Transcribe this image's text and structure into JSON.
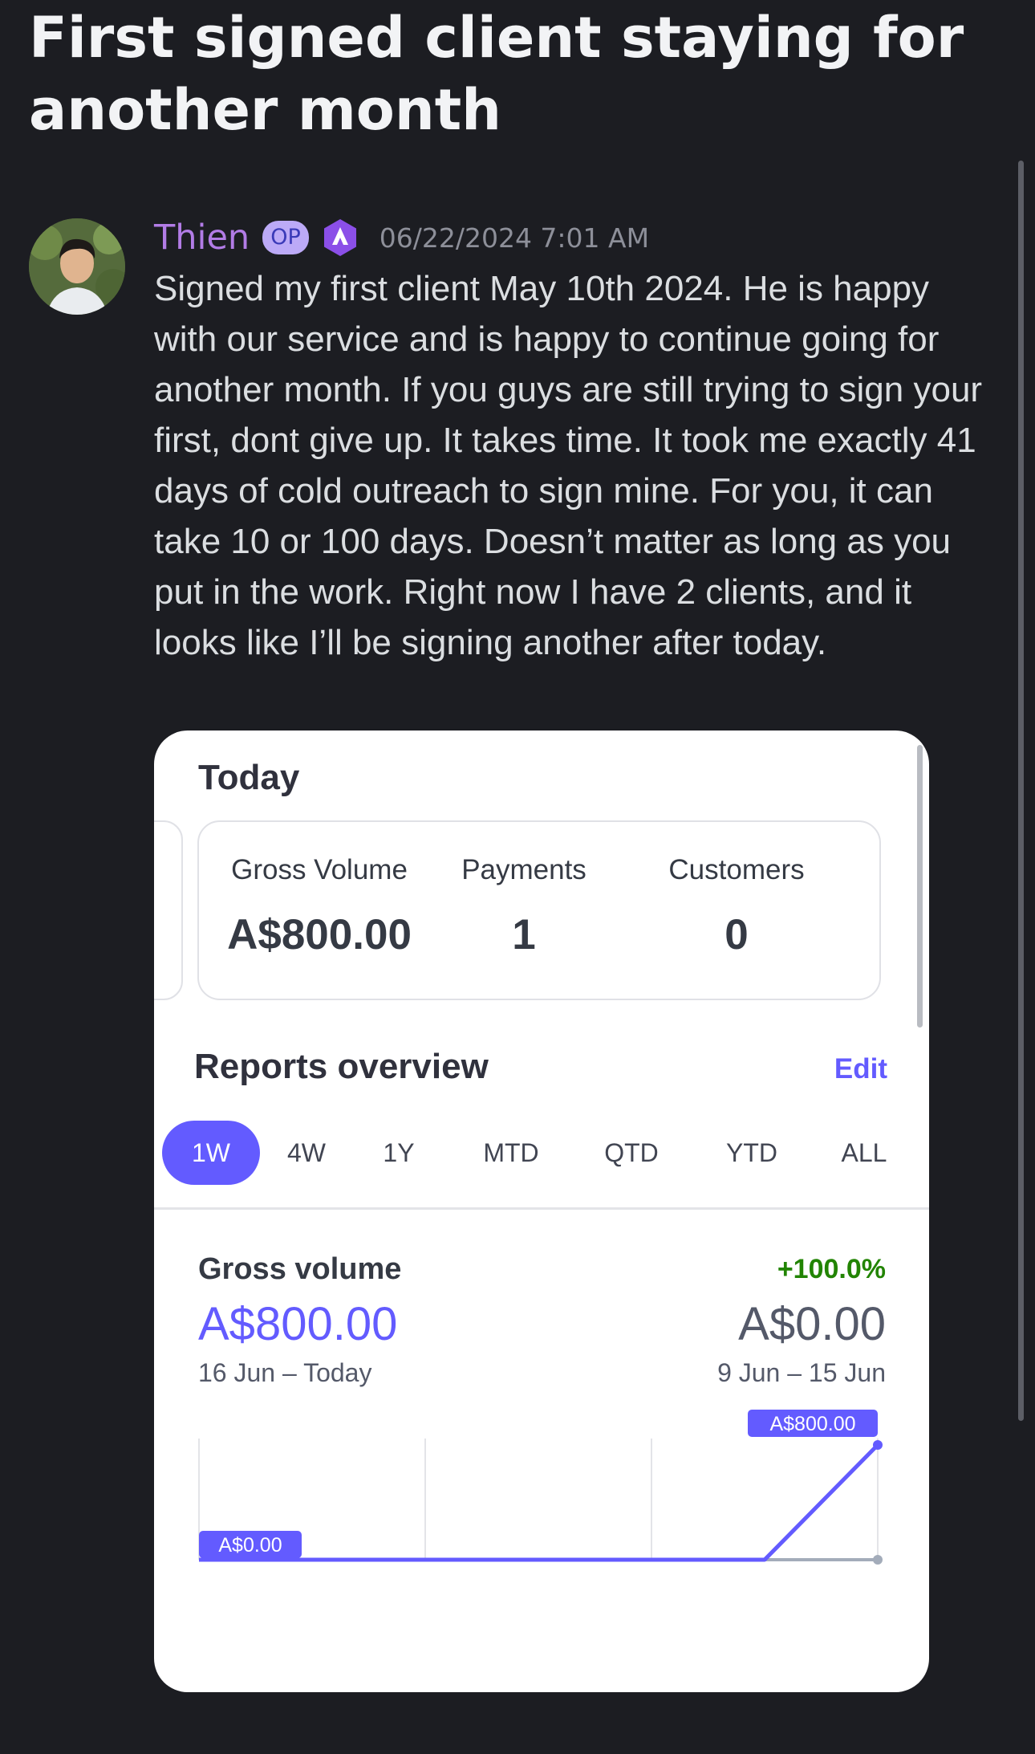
{
  "post": {
    "title": "First signed client staying for another month"
  },
  "message": {
    "author": "Thien",
    "op_badge": "OP",
    "role_icon": "purple-hexagon-logo-icon",
    "timestamp": "06/22/2024 7:01 AM",
    "body": "Signed my first client May 10th 2024. He is happy with our service and is happy to continue going for another month. If you guys are still trying to sign your first, dont give up. It takes time. It took me exactly 41 days of cold outreach to sign mine. For you, it can take 10 or 100 days. Doesn’t matter as long as you put in the work. Right now I have 2 clients, and it looks like I’ll be signing another after today."
  },
  "dashboard": {
    "today_heading": "Today",
    "stats": [
      {
        "label": "Gross Volume",
        "value": "A$800.00"
      },
      {
        "label": "Payments",
        "value": "1"
      },
      {
        "label": "Customers",
        "value": "0"
      }
    ],
    "reports_heading": "Reports overview",
    "edit_label": "Edit",
    "tabs": [
      "1W",
      "4W",
      "1Y",
      "MTD",
      "QTD",
      "YTD",
      "ALL"
    ],
    "active_tab": "1W",
    "gross_volume": {
      "label": "Gross volume",
      "value": "A$800.00",
      "range": "16 Jun – Today",
      "change": "+100.0%",
      "previous_value": "A$0.00",
      "previous_range": "9 Jun – 15 Jun"
    }
  },
  "chart_data": {
    "type": "line",
    "series": [
      {
        "values": [
          0,
          0,
          0,
          0,
          0,
          0,
          800
        ]
      },
      {
        "values": [
          0,
          0,
          0,
          0,
          0,
          0,
          0
        ]
      }
    ],
    "labels": {
      "start": "A$0.00",
      "end": "A$800.00"
    },
    "ylim": [
      0,
      800
    ],
    "colors": {
      "current": "#635bff",
      "previous": "#a3acba",
      "grid": "#e3e4e8"
    }
  },
  "colors": {
    "accent": "#635bff",
    "author": "#b27ce6",
    "positive": "#228403"
  }
}
